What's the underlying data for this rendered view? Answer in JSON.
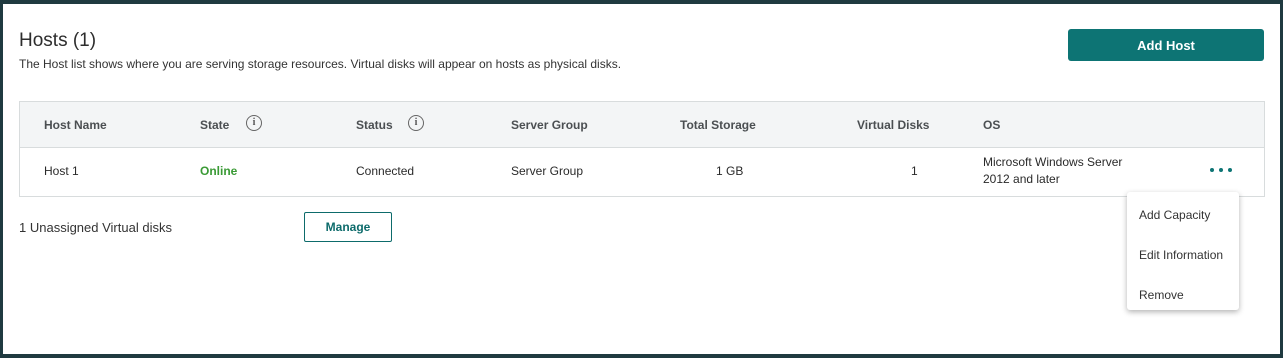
{
  "header": {
    "title": "Hosts (1)",
    "description": "The Host list shows where you are serving storage resources. Virtual disks will appear on hosts as physical disks.",
    "add_host_label": "Add Host"
  },
  "table": {
    "columns": [
      "Host Name",
      "State",
      "Status",
      "Server Group",
      "Total Storage",
      "Virtual Disks",
      "OS"
    ],
    "rows": [
      {
        "host_name": "Host 1",
        "state": "Online",
        "status": "Connected",
        "server_group": "Server Group",
        "total_storage": "1 GB",
        "virtual_disks": "1",
        "os_line1": "Microsoft Windows Server",
        "os_line2": "2012 and later"
      }
    ]
  },
  "unassigned": {
    "text": "1 Unassigned Virtual disks",
    "manage_label": "Manage"
  },
  "context_menu": {
    "items": [
      "Add Capacity",
      "Edit Information",
      "Remove"
    ]
  },
  "colors": {
    "accent": "#0d7474",
    "online": "#3a9a35"
  }
}
